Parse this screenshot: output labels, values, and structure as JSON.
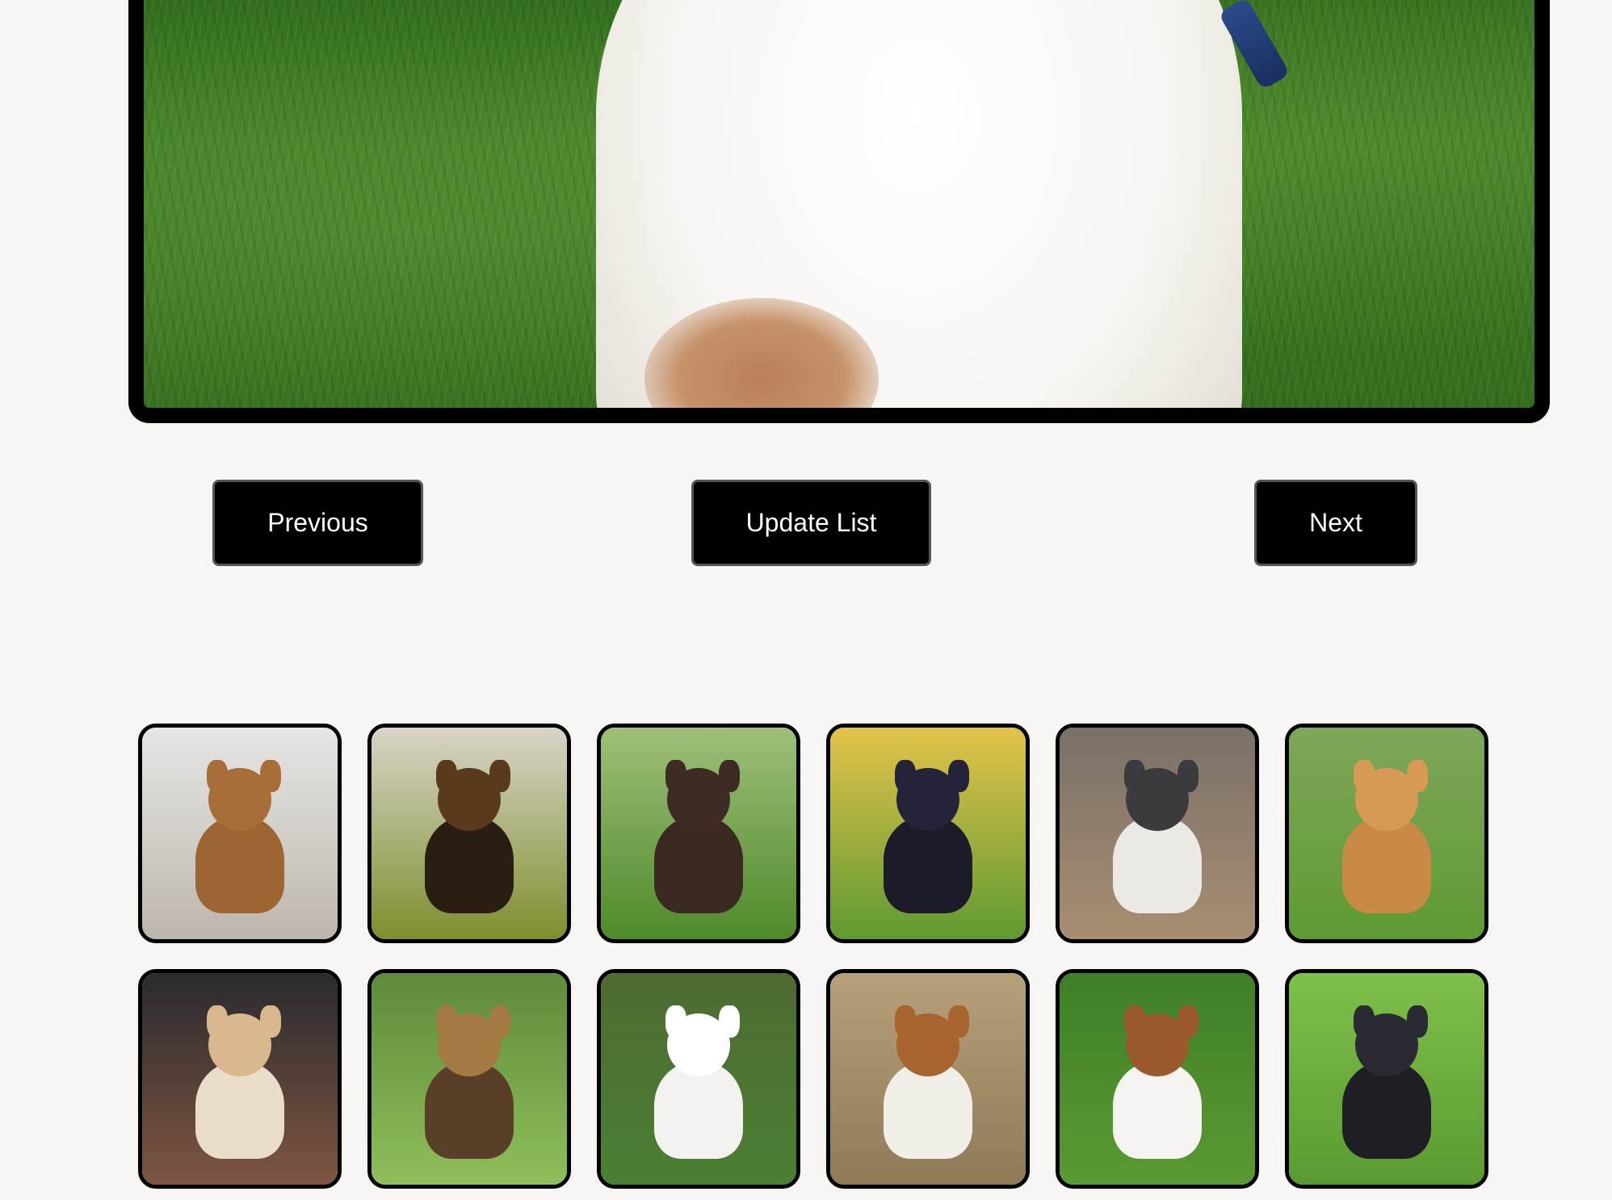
{
  "controls": {
    "previous_label": "Previous",
    "update_label": "Update List",
    "next_label": "Next"
  },
  "thumbnails": [
    {
      "name": "thumb-1",
      "bg_top": "#e7e6e4",
      "bg_bottom": "#bdb6ad",
      "dog": "#9c6532",
      "head": "#a86e3a"
    },
    {
      "name": "thumb-2",
      "bg_top": "#d9d4c8",
      "bg_bottom": "#7f8f2e",
      "dog": "#2a1d12",
      "head": "#5a3a1c"
    },
    {
      "name": "thumb-3",
      "bg_top": "#9fbf7a",
      "bg_bottom": "#4f8a2a",
      "dog": "#3a2a22",
      "head": "#3e2c24"
    },
    {
      "name": "thumb-4",
      "bg_top": "#e3c34a",
      "bg_bottom": "#5f9a32",
      "dog": "#1b1b2a",
      "head": "#23233a"
    },
    {
      "name": "thumb-5",
      "bg_top": "#7a7068",
      "bg_bottom": "#a88e72",
      "dog": "#ece9e4",
      "head": "#3b3b3f"
    },
    {
      "name": "thumb-6",
      "bg_top": "#7fa65a",
      "bg_bottom": "#5f9a32",
      "dog": "#c98a45",
      "head": "#d69a55"
    },
    {
      "name": "thumb-7",
      "bg_top": "#2a2a2e",
      "bg_bottom": "#7e5642",
      "dog": "#e9dcc8",
      "head": "#d9b88f"
    },
    {
      "name": "thumb-8",
      "bg_top": "#5f8a3a",
      "bg_bottom": "#8fbf5a",
      "dog": "#5a3f28",
      "head": "#a57a42"
    },
    {
      "name": "thumb-9",
      "bg_top": "#4f6a32",
      "bg_bottom": "#4a7f32",
      "dog": "#f4f2ef",
      "head": "#ffffff"
    },
    {
      "name": "thumb-10",
      "bg_top": "#b7a07a",
      "bg_bottom": "#8f7a58",
      "dog": "#f1eee8",
      "head": "#a8642e"
    },
    {
      "name": "thumb-11",
      "bg_top": "#3f7f28",
      "bg_bottom": "#5a9a32",
      "dog": "#f6f4f0",
      "head": "#9a5a2e"
    },
    {
      "name": "thumb-12",
      "bg_top": "#7fc04a",
      "bg_bottom": "#5a9a32",
      "dog": "#1e1e24",
      "head": "#2a2a32"
    }
  ]
}
